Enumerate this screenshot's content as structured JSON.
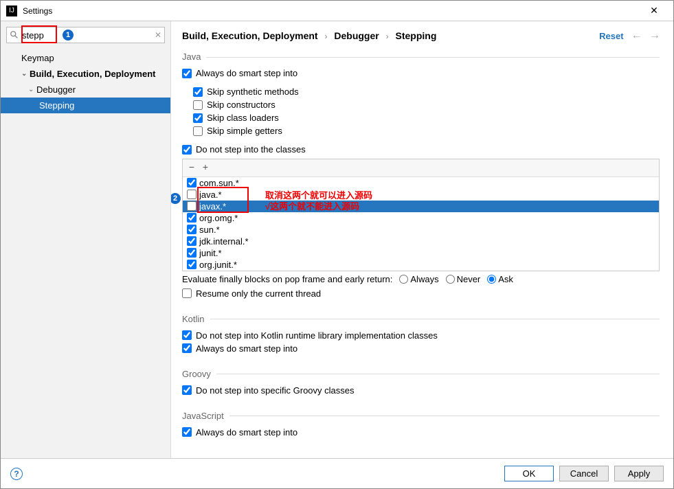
{
  "window": {
    "title": "Settings"
  },
  "search": {
    "value": "stepp"
  },
  "tree": {
    "keymap": "Keymap",
    "bed": "Build, Execution, Deployment",
    "debugger": "Debugger",
    "stepping": "Stepping"
  },
  "breadcrumb": {
    "a": "Build, Execution, Deployment",
    "b": "Debugger",
    "c": "Stepping"
  },
  "reset": "Reset",
  "java": {
    "title": "Java",
    "smart": "Always do smart step into",
    "synth": "Skip synthetic methods",
    "ctor": "Skip constructors",
    "loaders": "Skip class loaders",
    "getters": "Skip simple getters",
    "dontstep": "Do not step into the classes",
    "classes": [
      {
        "v": "com.sun.*",
        "c": true,
        "sel": false
      },
      {
        "v": "java.*",
        "c": false,
        "sel": false
      },
      {
        "v": "javax.*",
        "c": false,
        "sel": true
      },
      {
        "v": "org.omg.*",
        "c": true,
        "sel": false
      },
      {
        "v": "sun.*",
        "c": true,
        "sel": false
      },
      {
        "v": "jdk.internal.*",
        "c": true,
        "sel": false
      },
      {
        "v": "junit.*",
        "c": true,
        "sel": false
      },
      {
        "v": "org.junit.*",
        "c": true,
        "sel": false
      }
    ],
    "evalLabel": "Evaluate finally blocks on pop frame and early return:",
    "radios": {
      "always": "Always",
      "never": "Never",
      "ask": "Ask"
    },
    "resume": "Resume only the current thread"
  },
  "kotlin": {
    "title": "Kotlin",
    "dontstep": "Do not step into Kotlin runtime library implementation classes",
    "smart": "Always do smart step into"
  },
  "groovy": {
    "title": "Groovy",
    "dontstep": "Do not step into specific Groovy classes"
  },
  "js": {
    "title": "JavaScript",
    "smart": "Always do smart step into"
  },
  "buttons": {
    "ok": "OK",
    "cancel": "Cancel",
    "apply": "Apply"
  },
  "annotations": {
    "line1": "取消这两个就可以进入源码",
    "line2": "√这两个就不能进入源码"
  }
}
